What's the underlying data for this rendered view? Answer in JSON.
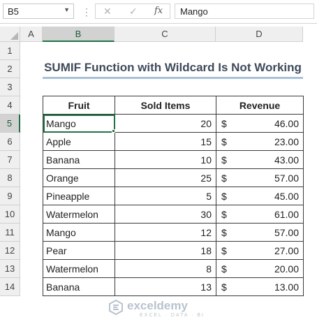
{
  "formula_bar": {
    "name_box": "B5",
    "separator": "⋮",
    "cancel_icon": "✕",
    "enter_icon": "✓",
    "fx_icon": "fx",
    "value": "Mango"
  },
  "columns": [
    "A",
    "B",
    "C",
    "D"
  ],
  "rows": [
    "1",
    "2",
    "3",
    "4",
    "5",
    "6",
    "7",
    "8",
    "9",
    "10",
    "11",
    "12",
    "13",
    "14"
  ],
  "selected_column": "B",
  "selected_row": "5",
  "title": "SUMIF Function with Wildcard Is Not Working",
  "table": {
    "headers": [
      "Fruit",
      "Sold Items",
      "Revenue"
    ],
    "currency_symbol": "$",
    "rows": [
      {
        "fruit": "Mango",
        "sold": "20",
        "revenue": "46.00"
      },
      {
        "fruit": "Apple",
        "sold": "15",
        "revenue": "23.00"
      },
      {
        "fruit": "Banana",
        "sold": "10",
        "revenue": "43.00"
      },
      {
        "fruit": "Orange",
        "sold": "25",
        "revenue": "57.00"
      },
      {
        "fruit": "Pineapple",
        "sold": "5",
        "revenue": "45.00"
      },
      {
        "fruit": "Watermelon",
        "sold": "30",
        "revenue": "61.00"
      },
      {
        "fruit": "Mango",
        "sold": "12",
        "revenue": "57.00"
      },
      {
        "fruit": "Pear",
        "sold": "18",
        "revenue": "27.00"
      },
      {
        "fruit": "Watermelon",
        "sold": "8",
        "revenue": "20.00"
      },
      {
        "fruit": "Banana",
        "sold": "13",
        "revenue": "13.00"
      }
    ]
  },
  "watermark": {
    "brand": "exceldemy",
    "tagline": "EXCEL · DATA · BI"
  },
  "colors": {
    "accent": "#217346",
    "title_text": "#3e4a5a",
    "title_underline": "#a9c1d9"
  }
}
